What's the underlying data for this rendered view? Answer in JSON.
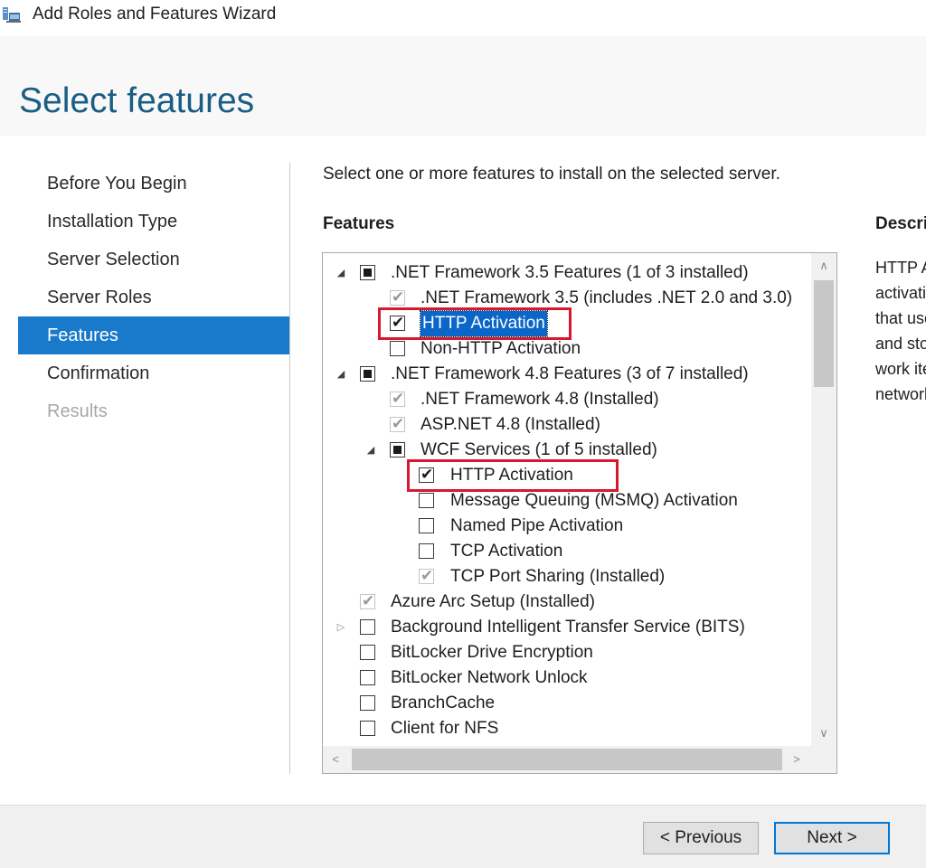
{
  "window": {
    "title": "Add Roles and Features Wizard",
    "icon": "server-manager-icon"
  },
  "page": {
    "title": "Select features"
  },
  "nav": {
    "items": [
      {
        "label": "Before You Begin",
        "state": "normal"
      },
      {
        "label": "Installation Type",
        "state": "normal"
      },
      {
        "label": "Server Selection",
        "state": "normal"
      },
      {
        "label": "Server Roles",
        "state": "normal"
      },
      {
        "label": "Features",
        "state": "active"
      },
      {
        "label": "Confirmation",
        "state": "normal"
      },
      {
        "label": "Results",
        "state": "disabled"
      }
    ]
  },
  "content": {
    "instructions": "Select one or more features to install on the selected server.",
    "features_heading": "Features",
    "description_heading": "Description",
    "description_lines": [
      "HTTP Activation supports process",
      "activation via HTTP. Applications",
      "that use HTTP Activation can start",
      "and stop dynamically in response to",
      "work items that arrive over the",
      "network via HTTP."
    ]
  },
  "tree": {
    "rows": [
      {
        "label": ".NET Framework 3.5 Features (1 of 3 installed)",
        "level": 0,
        "expander": "expanded",
        "check": "partial"
      },
      {
        "label": ".NET Framework 3.5 (includes .NET 2.0 and 3.0)",
        "level": 1,
        "expander": "none",
        "check": "installed"
      },
      {
        "label": "HTTP Activation",
        "level": 1,
        "expander": "none",
        "check": "checked",
        "selected": true,
        "highlight": true
      },
      {
        "label": "Non-HTTP Activation",
        "level": 1,
        "expander": "none",
        "check": "unchecked"
      },
      {
        "label": ".NET Framework 4.8 Features (3 of 7 installed)",
        "level": 0,
        "expander": "expanded",
        "check": "partial"
      },
      {
        "label": ".NET Framework 4.8 (Installed)",
        "level": 1,
        "expander": "none",
        "check": "installed"
      },
      {
        "label": "ASP.NET 4.8 (Installed)",
        "level": 1,
        "expander": "none",
        "check": "installed"
      },
      {
        "label": "WCF Services (1 of 5 installed)",
        "level": 1,
        "expander": "expanded",
        "check": "partial"
      },
      {
        "label": "HTTP Activation",
        "level": 2,
        "expander": "none",
        "check": "checked",
        "highlight": true
      },
      {
        "label": "Message Queuing (MSMQ) Activation",
        "level": 2,
        "expander": "none",
        "check": "unchecked"
      },
      {
        "label": "Named Pipe Activation",
        "level": 2,
        "expander": "none",
        "check": "unchecked"
      },
      {
        "label": "TCP Activation",
        "level": 2,
        "expander": "none",
        "check": "unchecked"
      },
      {
        "label": "TCP Port Sharing (Installed)",
        "level": 2,
        "expander": "none",
        "check": "installed"
      },
      {
        "label": "Azure Arc Setup (Installed)",
        "level": 0,
        "expander": "none",
        "check": "installed"
      },
      {
        "label": "Background Intelligent Transfer Service (BITS)",
        "level": 0,
        "expander": "collapsed",
        "check": "unchecked"
      },
      {
        "label": "BitLocker Drive Encryption",
        "level": 0,
        "expander": "none",
        "check": "unchecked"
      },
      {
        "label": "BitLocker Network Unlock",
        "level": 0,
        "expander": "none",
        "check": "unchecked"
      },
      {
        "label": "BranchCache",
        "level": 0,
        "expander": "none",
        "check": "unchecked"
      },
      {
        "label": "Client for NFS",
        "level": 0,
        "expander": "none",
        "check": "unchecked"
      }
    ]
  },
  "scrollbars": {
    "up_arrow": "∧",
    "down_arrow": "∨",
    "left_arrow": "<",
    "right_arrow": ">"
  },
  "footer": {
    "previous_label": "< Previous",
    "next_label": "Next >"
  }
}
